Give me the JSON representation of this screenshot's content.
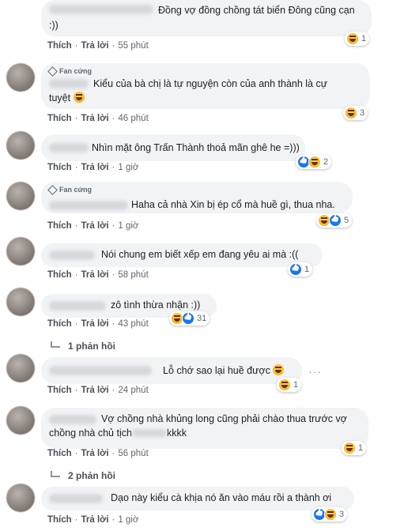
{
  "labels": {
    "like": "Thích",
    "reply": "Trả lời",
    "dot": "·",
    "fan": "Fan cứng",
    "more": "···"
  },
  "comments": [
    {
      "text": [
        "Đồng vợ đồng chồng tát biển Đông cũng cạn",
        ":))"
      ],
      "time": "55 phút",
      "reactions": [
        "haha"
      ],
      "count": "1"
    },
    {
      "text": [
        "Kiểu của bà chị là tự nguyện còn của anh thành là cự",
        "tuyệt"
      ],
      "fan": true,
      "time": "46 phút",
      "reactions": [
        "haha"
      ],
      "count": "3"
    },
    {
      "text": [
        "Nhìn mặt ông Trấn Thành thoả mãn ghê he =)))"
      ],
      "time": "1 giờ",
      "reactions": [
        "like",
        "haha"
      ],
      "count": "2"
    },
    {
      "text": [
        "Haha cả nhà Xin bị ép cổ mà huề gì, thua nha."
      ],
      "fan": true,
      "time": "1 giờ",
      "reactions": [
        "haha",
        "like"
      ],
      "count": "5"
    },
    {
      "text": [
        "Nói chung em biết xếp em đang yêu ai mà :(("
      ],
      "time": "58 phút",
      "reactions": [
        "like"
      ],
      "count": "1"
    },
    {
      "text": [
        "zô tình thừa nhận :))"
      ],
      "time": "43 phút",
      "reactions": [
        "haha",
        "like"
      ],
      "count": "31",
      "replies": "1 phản hồi"
    },
    {
      "text": [
        "Lỗ chớ sao lại huề được"
      ],
      "time": "24 phút",
      "reactions": [
        "haha"
      ],
      "count": "1"
    },
    {
      "text": [
        "Vợ chồng nhà khủng long cũng phải chào thua trước vợ",
        "chồng nhà chủ tịch",
        "kkkk"
      ],
      "time": "56 phút",
      "reactions": [
        "haha"
      ],
      "count": "1",
      "replies": "2 phản hồi"
    },
    {
      "text": [
        "Dạo này kiểu cà khịa nó ăn vào máu rồi a thành ơi"
      ],
      "time": "1 giờ",
      "reactions": [
        "like",
        "haha"
      ],
      "count": "3"
    }
  ]
}
